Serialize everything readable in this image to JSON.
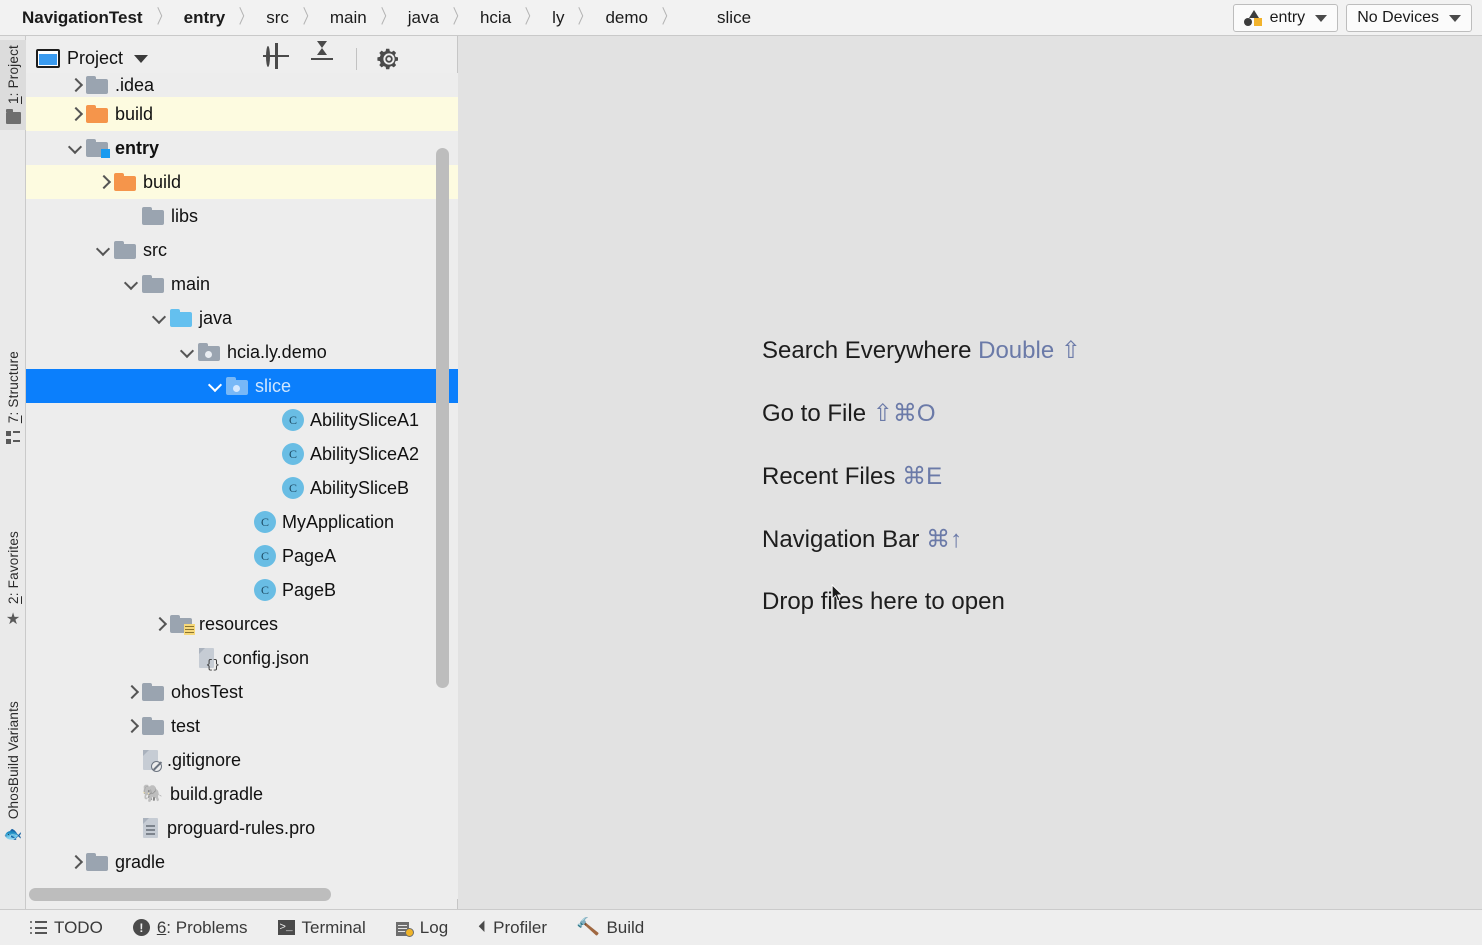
{
  "breadcrumb": {
    "items": [
      {
        "label": "NavigationTest",
        "bold": true
      },
      {
        "label": "entry",
        "bold": true
      },
      {
        "label": "src",
        "bold": false
      },
      {
        "label": "main",
        "bold": false
      },
      {
        "label": "java",
        "bold": false
      },
      {
        "label": "hcia",
        "bold": false
      },
      {
        "label": "ly",
        "bold": false
      },
      {
        "label": "demo",
        "bold": false
      }
    ],
    "current": "slice",
    "separator": "〉"
  },
  "toprright": {
    "run_config": "entry",
    "device": "No Devices"
  },
  "tool_window": {
    "title": "Project",
    "actions": [
      {
        "name": "select-opened-file",
        "icon": "locate-icon"
      },
      {
        "name": "collapse-all",
        "icon": "collapse-all-icon"
      },
      {
        "name": "settings",
        "icon": "gear-icon"
      },
      {
        "name": "hide",
        "icon": "minimize-icon"
      }
    ]
  },
  "left_tabs": [
    {
      "label": "1: Project",
      "icon": "folder-icon",
      "active": true,
      "mnemonic": "1"
    },
    {
      "label": "7: Structure",
      "icon": "structure-icon",
      "active": false,
      "mnemonic": "7"
    },
    {
      "label": "2: Favorites",
      "icon": "star-icon",
      "active": false,
      "mnemonic": "2"
    },
    {
      "label": "OhosBuild Variants",
      "icon": "variants-icon",
      "active": false,
      "mnemonic": ""
    }
  ],
  "tree": [
    {
      "label": ".idea",
      "indent": 1,
      "icon": "folder-gray",
      "chev": "right",
      "clipped": true
    },
    {
      "label": "build",
      "indent": 1,
      "icon": "folder-orange",
      "chev": "right",
      "excluded": true
    },
    {
      "label": "entry",
      "indent": 1,
      "icon": "folder-module",
      "chev": "down",
      "bold": true
    },
    {
      "label": "build",
      "indent": 2,
      "icon": "folder-orange",
      "chev": "right",
      "excluded": true
    },
    {
      "label": "libs",
      "indent": 3,
      "icon": "folder-gray",
      "chev": "none"
    },
    {
      "label": "src",
      "indent": 2,
      "icon": "folder-gray",
      "chev": "down"
    },
    {
      "label": "main",
      "indent": 3,
      "icon": "folder-gray",
      "chev": "down"
    },
    {
      "label": "java",
      "indent": 4,
      "icon": "folder-source",
      "chev": "down"
    },
    {
      "label": "hcia.ly.demo",
      "indent": 5,
      "icon": "folder-package",
      "chev": "down"
    },
    {
      "label": "slice",
      "indent": 6,
      "icon": "folder-package",
      "chev": "down",
      "selected": true
    },
    {
      "label": "AbilitySliceA1",
      "indent": 8,
      "icon": "java-class",
      "chev": "none"
    },
    {
      "label": "AbilitySliceA2",
      "indent": 8,
      "icon": "java-class",
      "chev": "none"
    },
    {
      "label": "AbilitySliceB",
      "indent": 8,
      "icon": "java-class",
      "chev": "none"
    },
    {
      "label": "MyApplication",
      "indent": 7,
      "icon": "java-class",
      "chev": "none"
    },
    {
      "label": "PageA",
      "indent": 7,
      "icon": "java-class",
      "chev": "none"
    },
    {
      "label": "PageB",
      "indent": 7,
      "icon": "java-class",
      "chev": "none"
    },
    {
      "label": "resources",
      "indent": 4,
      "icon": "folder-resources",
      "chev": "right"
    },
    {
      "label": "config.json",
      "indent": 5,
      "icon": "json-file",
      "chev": "none"
    },
    {
      "label": "ohosTest",
      "indent": 3,
      "icon": "folder-gray",
      "chev": "right"
    },
    {
      "label": "test",
      "indent": 3,
      "icon": "folder-gray",
      "chev": "right"
    },
    {
      "label": ".gitignore",
      "indent": 3,
      "icon": "ignored-file",
      "chev": "none"
    },
    {
      "label": "build.gradle",
      "indent": 3,
      "icon": "gradle-file",
      "chev": "none"
    },
    {
      "label": "proguard-rules.pro",
      "indent": 3,
      "icon": "text-file",
      "chev": "none"
    },
    {
      "label": "gradle",
      "indent": 1,
      "icon": "folder-gray",
      "chev": "right"
    }
  ],
  "editor_hints": [
    {
      "action": "Search Everywhere",
      "shortcut": "Double ⇧"
    },
    {
      "action": "Go to File",
      "shortcut": "⇧⌘O"
    },
    {
      "action": "Recent Files",
      "shortcut": "⌘E"
    },
    {
      "action": "Navigation Bar",
      "shortcut": "⌘↑"
    },
    {
      "action": "Drop files here to open",
      "shortcut": ""
    }
  ],
  "status_bar": [
    {
      "label": "TODO",
      "icon": "todo-icon",
      "prefix": "",
      "mnemonic": ""
    },
    {
      "label": ": Problems",
      "icon": "problems-icon",
      "prefix": "6",
      "mnemonic": "6"
    },
    {
      "label": "Terminal",
      "icon": "terminal-icon",
      "prefix": "",
      "mnemonic": ""
    },
    {
      "label": "Log",
      "icon": "log-icon",
      "prefix": "",
      "mnemonic": ""
    },
    {
      "label": "Profiler",
      "icon": "profiler-icon",
      "prefix": "",
      "mnemonic": ""
    },
    {
      "label": "Build",
      "icon": "build-icon",
      "prefix": "",
      "mnemonic": ""
    }
  ],
  "colors": {
    "selection": "#0b7ffc",
    "excluded_row": "#fdfbe0",
    "editor_bg": "#e2e2e2",
    "tree_bg": "#ededed",
    "shortcut": "#6b7aa8"
  }
}
